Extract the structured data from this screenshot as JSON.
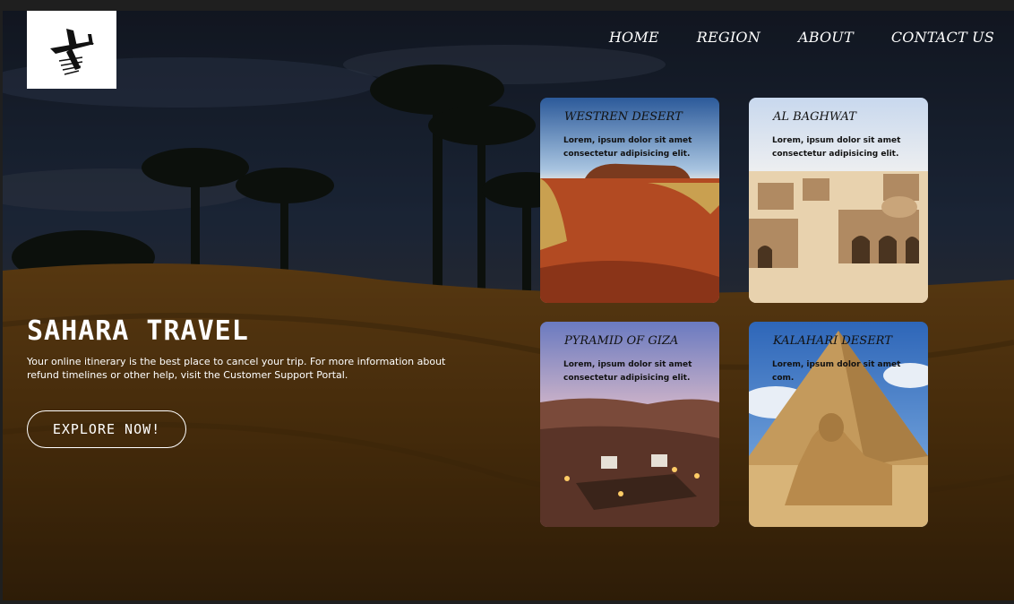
{
  "nav": {
    "items": [
      "HOME",
      "REGION",
      "ABOUT",
      "CONTACT US"
    ]
  },
  "hero": {
    "title": "SAHARA TRAVEL",
    "description": "Your online itinerary is the best place to cancel your trip. For more information about refund timelines or other help, visit the Customer Support Portal.",
    "button": "EXPLORE NOW!"
  },
  "cards": [
    {
      "title": "WESTREN DESERT",
      "text": "Lorem, ipsum dolor sit amet consectetur adipisicing elit."
    },
    {
      "title": "AL BAGHWAT",
      "text": "Lorem, ipsum dolor sit amet consectetur adipisicing elit."
    },
    {
      "title": "PYRAMID OF GIZA",
      "text": "Lorem, ipsum dolor sit amet consectetur adipisicing elit."
    },
    {
      "title": "KALAHARI DESERT",
      "text": "Lorem, ipsum dolor sit amet com."
    }
  ],
  "colors": {
    "overlay": "#000000",
    "sand": "#8a5a18",
    "sky": "#2e4466"
  },
  "icons": {
    "logo": "airplane-logo-icon"
  }
}
